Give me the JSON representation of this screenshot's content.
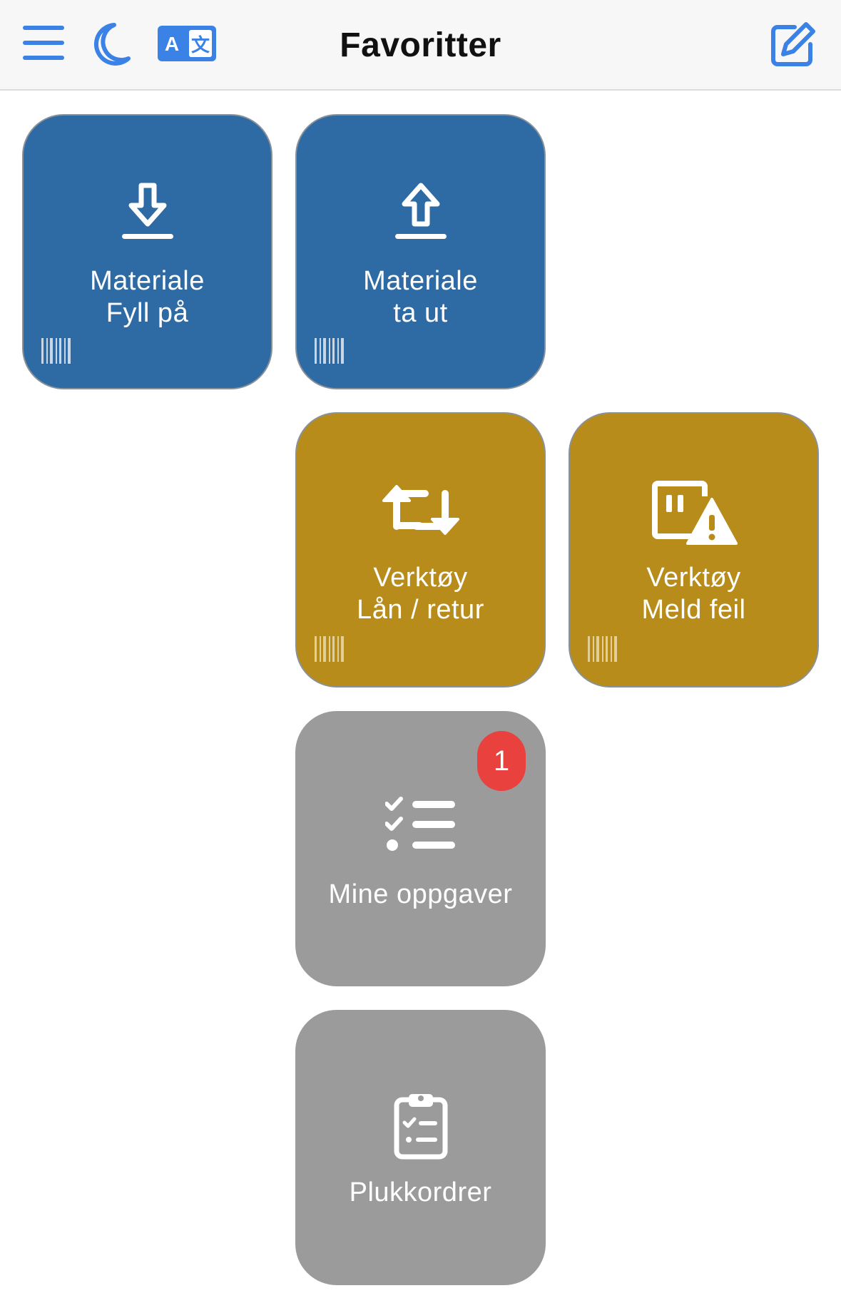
{
  "header": {
    "title": "Favoritter",
    "accent_color": "#3b82e6",
    "icons": [
      "hamburger-menu-icon",
      "moon-icon",
      "translate-icon",
      "edit-icon"
    ]
  },
  "tiles": [
    {
      "line1": "Materiale",
      "line2": "Fyll på",
      "color": "#2e6aa3",
      "icon": "download-icon",
      "barcode": true
    },
    {
      "line1": "Materiale",
      "line2": "ta ut",
      "color": "#2e6aa3",
      "icon": "upload-icon",
      "barcode": true
    },
    {
      "line1": "Verktøy",
      "line2": "Lån / retur",
      "color": "#b88c1a",
      "icon": "loan-return-icon",
      "barcode": true
    },
    {
      "line1": "Verktøy",
      "line2": "Meld feil",
      "color": "#b88c1a",
      "icon": "report-fault-icon",
      "barcode": true
    },
    {
      "line1": "Mine oppgaver",
      "color": "#9b9b9b",
      "icon": "task-list-icon",
      "badge": "1",
      "badge_color": "#e8413e"
    },
    {
      "line1": "Plukkordrer",
      "color": "#9b9b9b",
      "icon": "clipboard-checklist-icon"
    }
  ]
}
